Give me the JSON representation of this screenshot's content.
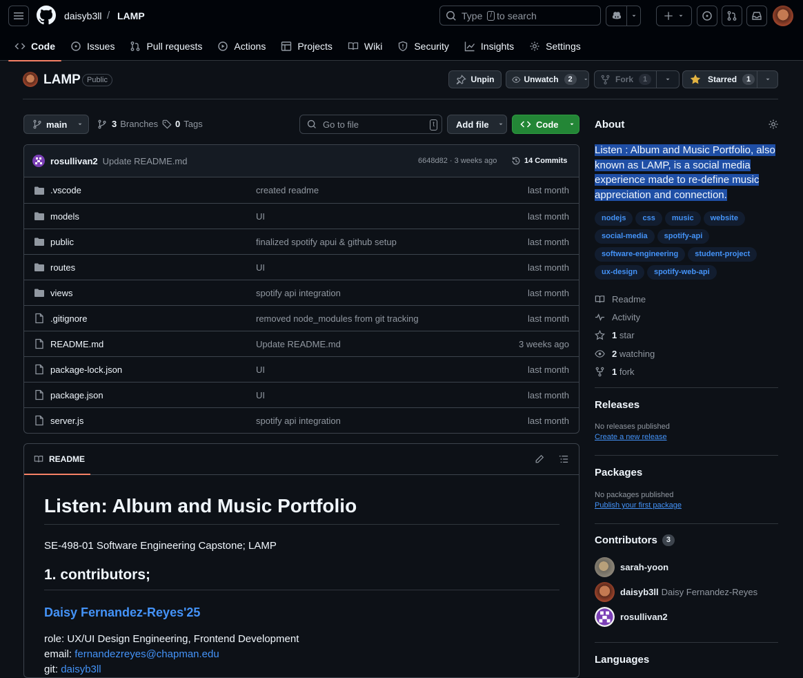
{
  "header": {
    "owner": "daisyb3ll",
    "separator": "/",
    "repo": "LAMP",
    "search": {
      "prefix": "Type",
      "key": "/",
      "suffix": "to search"
    }
  },
  "nav_tabs": [
    {
      "label": "Code",
      "icon": "code-icon",
      "active": true
    },
    {
      "label": "Issues",
      "icon": "issue-icon"
    },
    {
      "label": "Pull requests",
      "icon": "pull-request-icon"
    },
    {
      "label": "Actions",
      "icon": "play-icon"
    },
    {
      "label": "Projects",
      "icon": "table-icon"
    },
    {
      "label": "Wiki",
      "icon": "book-icon"
    },
    {
      "label": "Security",
      "icon": "shield-icon"
    },
    {
      "label": "Insights",
      "icon": "graph-icon"
    },
    {
      "label": "Settings",
      "icon": "gear-icon"
    }
  ],
  "repo_header": {
    "name": "LAMP",
    "visibility": "Public",
    "unpin": "Unpin",
    "unwatch": "Unwatch",
    "watch_count": "2",
    "fork": "Fork",
    "fork_count": "1",
    "starred": "Starred",
    "star_count": "1"
  },
  "toolbar": {
    "branch": "main",
    "branches_count": "3",
    "branches_label": "Branches",
    "tags_count": "0",
    "tags_label": "Tags",
    "go_to_file": "Go to file",
    "go_to_file_key": "t",
    "add_file": "Add file",
    "code": "Code"
  },
  "latest_commit": {
    "author": "rosullivan2",
    "message": "Update README.md",
    "hash_time": "6648d82 · 3 weeks ago",
    "commits": "14 Commits"
  },
  "files": [
    {
      "name": ".vscode",
      "type": "dir",
      "message": "created readme",
      "date": "last month"
    },
    {
      "name": "models",
      "type": "dir",
      "message": "UI",
      "date": "last month"
    },
    {
      "name": "public",
      "type": "dir",
      "message": "finalized spotify apui & github setup",
      "date": "last month"
    },
    {
      "name": "routes",
      "type": "dir",
      "message": "UI",
      "date": "last month"
    },
    {
      "name": "views",
      "type": "dir",
      "message": "spotify api integration",
      "date": "last month"
    },
    {
      "name": ".gitignore",
      "type": "file",
      "message": "removed node_modules from git tracking",
      "date": "last month"
    },
    {
      "name": "README.md",
      "type": "file",
      "message": "Update README.md",
      "date": "3 weeks ago"
    },
    {
      "name": "package-lock.json",
      "type": "file",
      "message": "UI",
      "date": "last month"
    },
    {
      "name": "package.json",
      "type": "file",
      "message": "UI",
      "date": "last month"
    },
    {
      "name": "server.js",
      "type": "file",
      "message": "spotify api integration",
      "date": "last month"
    }
  ],
  "readme": {
    "tab": "README",
    "h1": "Listen: Album and Music Portfolio",
    "subtitle": "SE-498-01 Software Engineering Capstone; LAMP",
    "h2": "1. contributors;",
    "person": "Daisy Fernandez-Reyes'25",
    "role": "role: UX/UI Design Engineering, Frontend Development",
    "email_label": "email:",
    "email": "fernandezreyes@chapman.edu",
    "git_label": "git:",
    "git": "daisyb3ll"
  },
  "about": {
    "title": "About",
    "description": "Listen : Album and Music Portfolio, also known as LAMP, is a social media experience made to re-define music appreciation and connection.",
    "topics": [
      "nodejs",
      "css",
      "music",
      "website",
      "social-media",
      "spotify-api",
      "software-engineering",
      "student-project",
      "ux-design",
      "spotify-web-api"
    ],
    "links": [
      {
        "icon": "book-icon",
        "strong": "",
        "text": "Readme"
      },
      {
        "icon": "pulse-icon",
        "strong": "",
        "text": "Activity"
      },
      {
        "icon": "star-icon",
        "strong": "1",
        "text": "star"
      },
      {
        "icon": "eye-icon",
        "strong": "2",
        "text": "watching"
      },
      {
        "icon": "fork-icon",
        "strong": "1",
        "text": "fork"
      }
    ]
  },
  "releases": {
    "title": "Releases",
    "none": "No releases published",
    "link": "Create a new release"
  },
  "packages": {
    "title": "Packages",
    "none": "No packages published",
    "link": "Publish your first package"
  },
  "contributors": {
    "title": "Contributors",
    "count": "3",
    "people": [
      {
        "login": "sarah-yoon",
        "name": ""
      },
      {
        "login": "daisyb3ll",
        "name": "Daisy Fernandez-Reyes"
      },
      {
        "login": "rosullivan2",
        "name": ""
      }
    ]
  },
  "languages": {
    "title": "Languages"
  },
  "colors": {
    "accent": "#4493f8",
    "tab_underline": "#f78166",
    "green": "#238636",
    "star": "#e3b341",
    "highlight": "#1f4fa6"
  }
}
